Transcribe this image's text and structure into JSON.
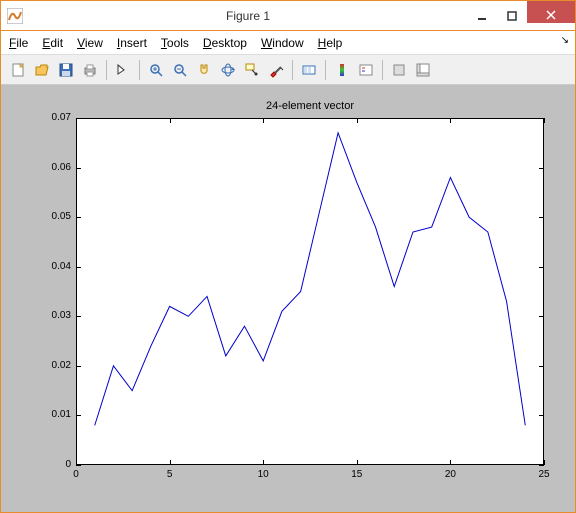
{
  "window": {
    "title": "Figure 1"
  },
  "menu": {
    "file": "File",
    "edit": "Edit",
    "view": "View",
    "insert": "Insert",
    "tools": "Tools",
    "desktop": "Desktop",
    "window": "Window",
    "help": "Help"
  },
  "toolbar": {
    "new": "New Figure",
    "open": "Open",
    "save": "Save",
    "print": "Print",
    "edit_plot": "Edit Plot",
    "zoom_in": "Zoom In",
    "zoom_out": "Zoom Out",
    "pan": "Pan",
    "rotate": "Rotate 3D",
    "data_cursor": "Data Cursor",
    "brush": "Brush",
    "link": "Link Plot",
    "colorbar": "Insert Colorbar",
    "legend": "Insert Legend",
    "hide": "Hide Plot Tools",
    "show": "Show Plot Tools"
  },
  "chart_data": {
    "type": "line",
    "title": "24-element vector",
    "xlabel": "",
    "ylabel": "",
    "xlim": [
      0,
      25
    ],
    "ylim": [
      0,
      0.07
    ],
    "xticks": [
      0,
      5,
      10,
      15,
      20,
      25
    ],
    "yticks": [
      0,
      0.01,
      0.02,
      0.03,
      0.04,
      0.05,
      0.06,
      0.07
    ],
    "x": [
      1,
      2,
      3,
      4,
      5,
      6,
      7,
      8,
      9,
      10,
      11,
      12,
      13,
      14,
      15,
      16,
      17,
      18,
      19,
      20,
      21,
      22,
      23,
      24
    ],
    "values": [
      0.008,
      0.02,
      0.015,
      0.024,
      0.032,
      0.03,
      0.034,
      0.022,
      0.028,
      0.021,
      0.031,
      0.035,
      0.051,
      0.067,
      0.057,
      0.048,
      0.036,
      0.047,
      0.048,
      0.058,
      0.05,
      0.047,
      0.033,
      0.008
    ]
  }
}
